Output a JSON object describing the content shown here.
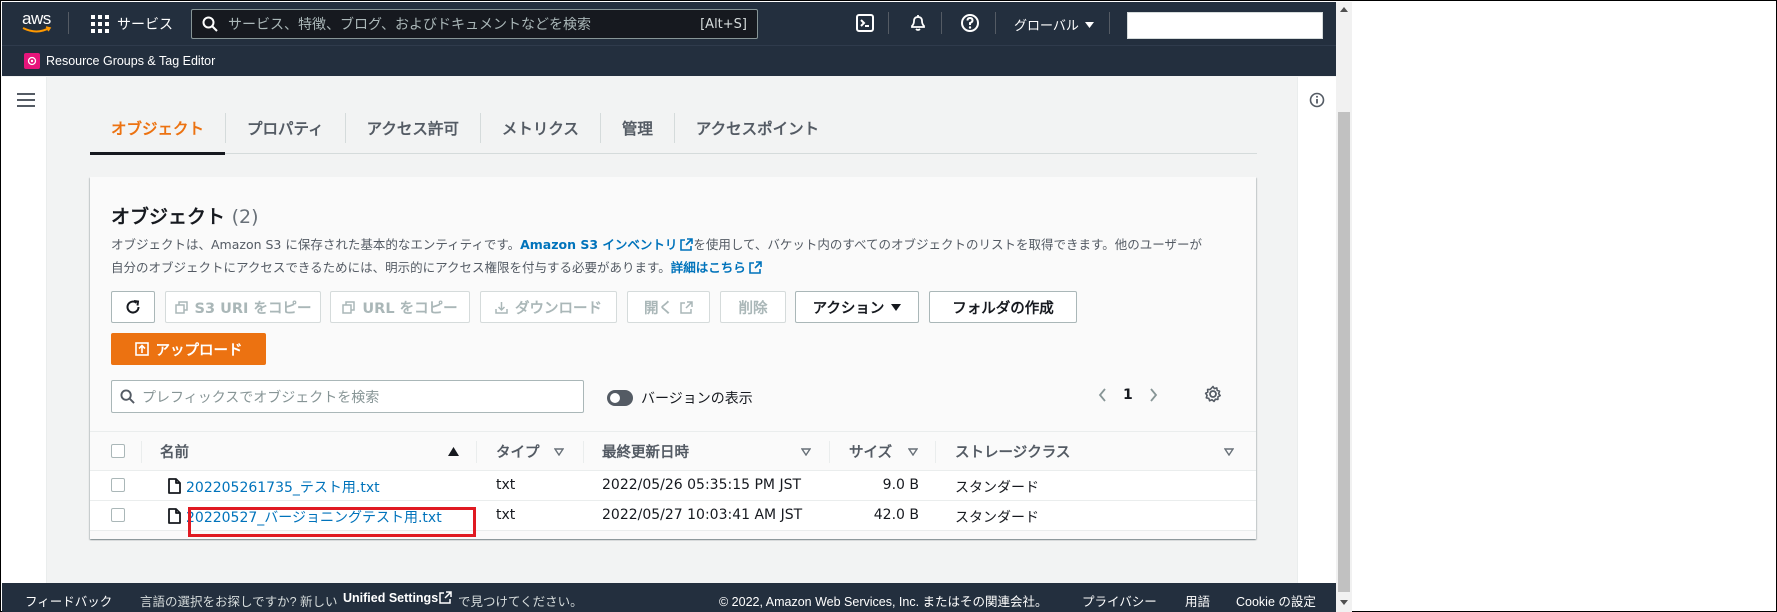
{
  "topnav": {
    "logo_text": "aws",
    "services_label": "サービス",
    "search_placeholder": "サービス、特徴、ブログ、およびドキュメントなどを検索",
    "search_shortcut": "[Alt+S]",
    "region_label": "グローバル"
  },
  "subnav": {
    "resource_groups_label": "Resource Groups & Tag Editor"
  },
  "tabs": [
    {
      "label": "オブジェクト",
      "active": true
    },
    {
      "label": "プロパティ",
      "active": false
    },
    {
      "label": "アクセス許可",
      "active": false
    },
    {
      "label": "メトリクス",
      "active": false
    },
    {
      "label": "管理",
      "active": false
    },
    {
      "label": "アクセスポイント",
      "active": false
    }
  ],
  "panel": {
    "title": "オブジェクト",
    "count": "(2)",
    "desc_part1": "オブジェクトは、Amazon S3 に保存された基本的なエンティティです。",
    "desc_link1": "Amazon S3 インベントリ",
    "desc_part2": "を使用して、バケット内のすべてのオブジェクトのリストを取得できます。他のユーザーが",
    "desc_part3": "自分のオブジェクトにアクセスできるためには、明示的にアクセス権限を付与する必要があります。",
    "desc_link2": "詳細はこちら"
  },
  "toolbar": {
    "copy_s3_uri": "S3 URI をコピー",
    "copy_url": "URL をコピー",
    "download": "ダウンロード",
    "open": "開く",
    "delete": "削除",
    "actions": "アクション",
    "create_folder": "フォルダの作成",
    "upload": "アップロード"
  },
  "filter": {
    "search_placeholder": "プレフィックスでオブジェクトを検索",
    "version_toggle_label": "バージョンの表示",
    "current_page": "1"
  },
  "table": {
    "columns": [
      "名前",
      "タイプ",
      "最終更新日時",
      "サイズ",
      "ストレージクラス"
    ],
    "rows": [
      {
        "name": "202205261735_テスト用.txt",
        "type": "txt",
        "modified": "2022/05/26 05:35:15 PM JST",
        "size": "9.0 B",
        "storage": "スタンダード"
      },
      {
        "name": "20220527_バージョニングテスト用.txt",
        "type": "txt",
        "modified": "2022/05/27 10:03:41 AM JST",
        "size": "42.0 B",
        "storage": "スタンダード"
      }
    ]
  },
  "footer": {
    "feedback": "フィードバック",
    "language_prefix": "言語の選択をお探しですか? 新しい",
    "unified_settings": "Unified Settings",
    "language_suffix": "で見つけてください。",
    "copyright": "© 2022, Amazon Web Services, Inc. またはその関連会社。",
    "privacy": "プライバシー",
    "terms": "用語",
    "cookie": "Cookie の設定"
  },
  "colors": {
    "nav_bg": "#232f3e",
    "accent_orange": "#ec7211",
    "link_blue": "#0073bb",
    "highlight_red": "#e01a22"
  }
}
